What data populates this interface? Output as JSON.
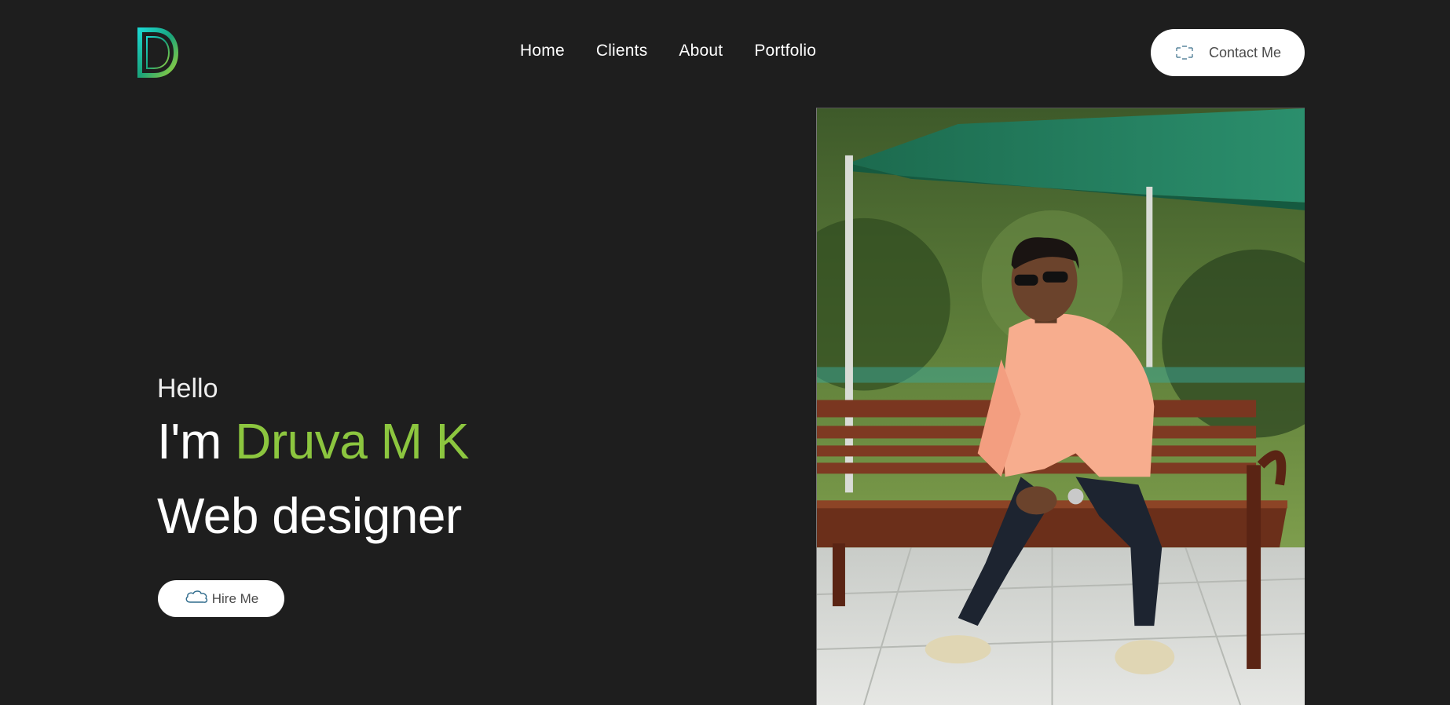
{
  "brand": {
    "logo_letter": "D"
  },
  "nav": {
    "items": [
      {
        "label": "Home"
      },
      {
        "label": "Clients"
      },
      {
        "label": "About"
      },
      {
        "label": "Portfolio"
      }
    ]
  },
  "header": {
    "contact_label": "Contact Me",
    "contact_icon": "message-icon"
  },
  "hero": {
    "greeting": "Hello",
    "intro_prefix": "I'm",
    "name": "Druva M K",
    "role": "Web designer",
    "hire_label": "Hire Me",
    "hire_icon": "cloud-icon"
  },
  "colors": {
    "background": "#1e1e1e",
    "accent": "#8cc63f",
    "button_bg": "#ffffff"
  }
}
